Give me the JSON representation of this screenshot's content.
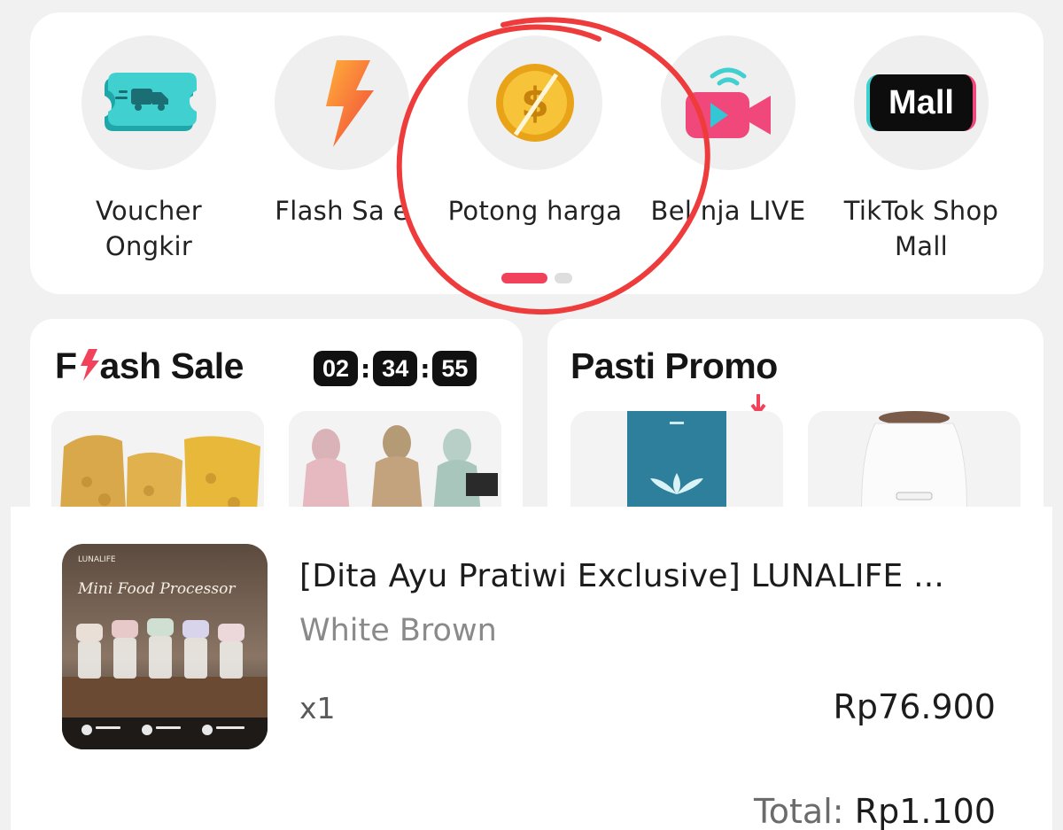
{
  "categories": [
    {
      "label": "Voucher\nOngkir",
      "icon": "voucher-shipping-icon"
    },
    {
      "label": "Flash Sa e",
      "icon": "lightning-icon"
    },
    {
      "label": "Potong harga",
      "icon": "dollar-coin-icon"
    },
    {
      "label": "Bel nja LIVE",
      "icon": "live-video-icon"
    },
    {
      "label": "TikTok Shop\nMall",
      "icon": "mall-badge-icon",
      "badge_text": "Mall"
    }
  ],
  "pager": {
    "active_index": 0,
    "count": 2
  },
  "flash_sale": {
    "title_prefix": "F",
    "title_suffix": "ash Sale",
    "timer": {
      "hours": "02",
      "minutes": "34",
      "seconds": "55"
    }
  },
  "pasti_promo": {
    "title_left": "Pasti Prom",
    "title_right": "o"
  },
  "order": {
    "product_title": "[Dita Ayu Pratiwi Exclusive] LUNALIFE ...",
    "variant": "White Brown",
    "quantity": "x1",
    "price": "Rp76.900",
    "total_label": "Total:",
    "total_value": "Rp1.100",
    "image_brand": "LUNALIFE",
    "image_caption": "Mini Food Processor"
  },
  "colors": {
    "accent_red": "#f2415a",
    "annotation_red": "#ee3b3b",
    "background": "#f1f1f1"
  }
}
